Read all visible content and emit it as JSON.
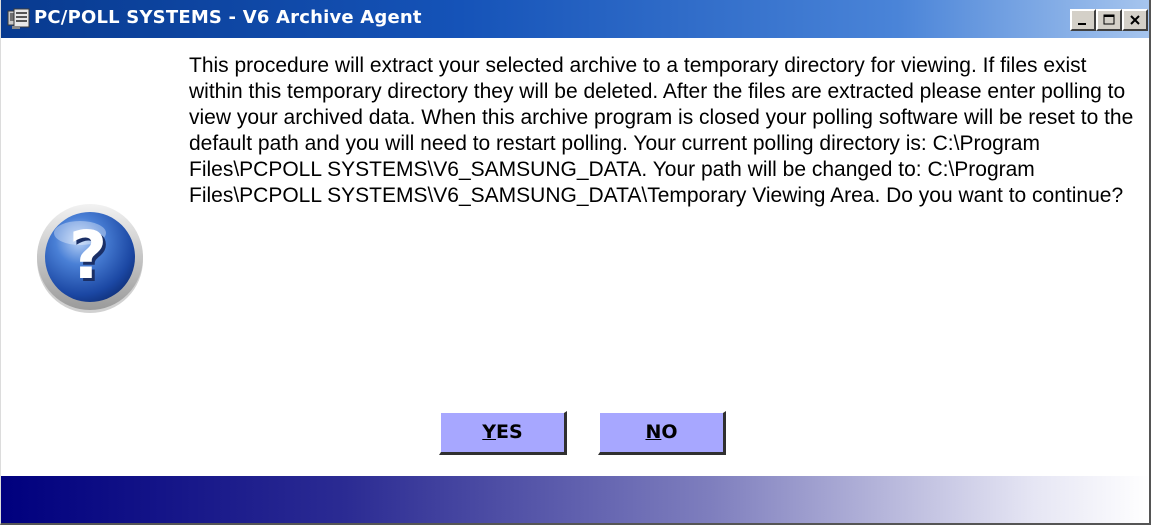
{
  "window": {
    "title": "PC/POLL SYSTEMS - V6 Archive Agent",
    "controls": {
      "minimize": "minimize-icon",
      "maximize": "maximize-icon",
      "close": "close-icon"
    }
  },
  "dialog": {
    "icon": "question-help-icon",
    "message": "This procedure will extract your selected archive to a temporary directory for viewing. If files exist within this temporary directory they will be deleted.  After the files are extracted please enter polling to view your archived data.  When this archive program is closed your polling software will be reset to the default path and you will need to restart polling.  Your current polling directory is: C:\\Program Files\\PCPOLL SYSTEMS\\V6_SAMSUNG_DATA.  Your path will be changed to: C:\\Program Files\\PCPOLL SYSTEMS\\V6_SAMSUNG_DATA\\Temporary Viewing Area.  Do you want to continue?"
  },
  "buttons": {
    "yes": {
      "accel": "Y",
      "rest": "ES"
    },
    "no": {
      "accel": "N",
      "rest": "O"
    }
  },
  "colors": {
    "titlebar_start": "#083a8f",
    "titlebar_end": "#a6c5ee",
    "button_face": "#a7a7ff",
    "bottom_bar_start": "#00007e",
    "bottom_bar_end": "#ffffff"
  }
}
